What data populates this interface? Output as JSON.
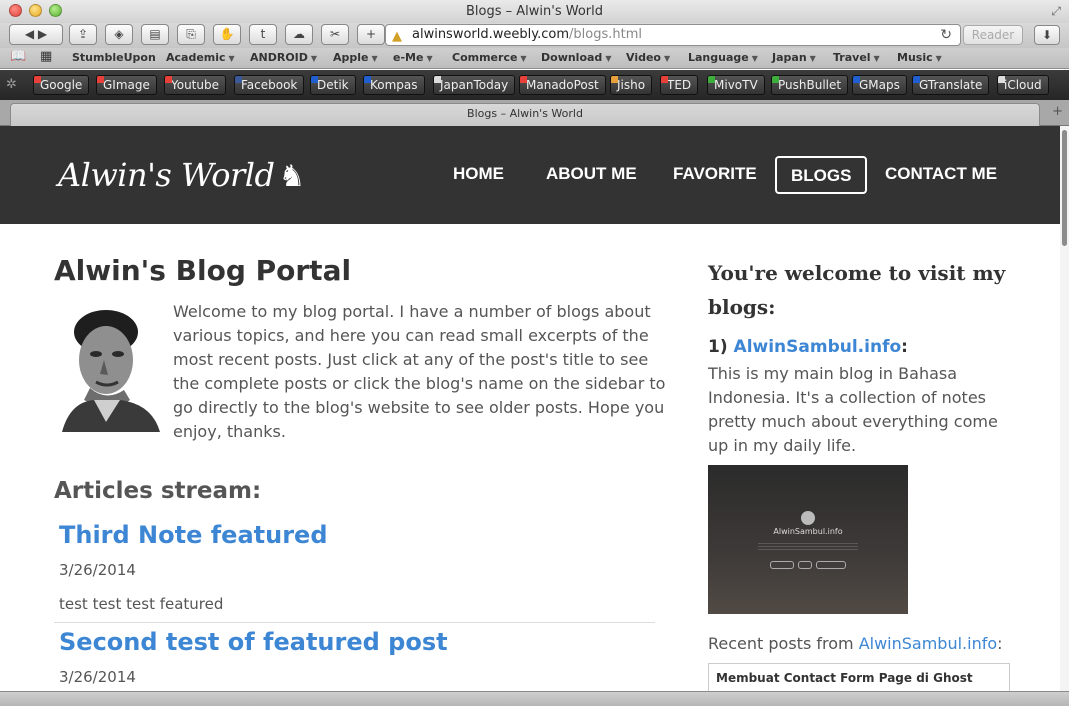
{
  "window": {
    "title": "Blogs – Alwin's World"
  },
  "toolbar": {
    "url_host": "alwinsworld.weebly.com",
    "url_path": "/blogs.html",
    "reader_label": "Reader"
  },
  "bookmarks": [
    {
      "label": "StumbleUpon",
      "menu": false
    },
    {
      "label": "Academic",
      "menu": true
    },
    {
      "label": "ANDROID",
      "menu": true
    },
    {
      "label": "Apple",
      "menu": true
    },
    {
      "label": "e-Me",
      "menu": true
    },
    {
      "label": "Commerce",
      "menu": true
    },
    {
      "label": "Download",
      "menu": true
    },
    {
      "label": "Video",
      "menu": true
    },
    {
      "label": "Language",
      "menu": true
    },
    {
      "label": "Japan",
      "menu": true
    },
    {
      "label": "Travel",
      "menu": true
    },
    {
      "label": "Music",
      "menu": true
    }
  ],
  "extensions": [
    {
      "label": "Google",
      "color": "#e8413a"
    },
    {
      "label": "GImage",
      "color": "#e8413a"
    },
    {
      "label": "Youtube",
      "color": "#e8413a"
    },
    {
      "label": "Facebook",
      "color": "#3b5998"
    },
    {
      "label": "Detik",
      "color": "#1f5fd0"
    },
    {
      "label": "Kompas",
      "color": "#1f5fd0"
    },
    {
      "label": "JapanToday",
      "color": "#dddddd"
    },
    {
      "label": "ManadoPost",
      "color": "#e8413a"
    },
    {
      "label": "Jisho",
      "color": "#e8a13a"
    },
    {
      "label": "TED",
      "color": "#e8413a"
    },
    {
      "label": "MivoTV",
      "color": "#3cae3c"
    },
    {
      "label": "PushBullet",
      "color": "#3cae3c"
    },
    {
      "label": "GMaps",
      "color": "#1f5fd0"
    },
    {
      "label": "GTranslate",
      "color": "#1f5fd0"
    },
    {
      "label": "iCloud",
      "color": "#dddddd"
    }
  ],
  "tab": {
    "title": "Blogs – Alwin's World"
  },
  "site": {
    "logo": "Alwin's World",
    "nav": [
      "HOME",
      "ABOUT ME",
      "FAVORITE",
      "BLOGS",
      "CONTACT ME"
    ],
    "active_nav": "BLOGS"
  },
  "main": {
    "heading": "Alwin's Blog Portal",
    "intro": "Welcome to my blog portal. I have a number of blogs about various topics, and here you can read small excerpts of the most recent posts.  Just click at any of the post's title to see the complete posts or click the blog's name on the sidebar to go directly to the blog's website to see older posts. Hope you enjoy, thanks.",
    "stream_heading": "Articles stream:",
    "posts": [
      {
        "title": "Third Note featured",
        "date": "3/26/2014",
        "excerpt": "test test test featured"
      },
      {
        "title": "Second test of featured post",
        "date": "3/26/2014",
        "excerpt": ""
      }
    ]
  },
  "sidebar": {
    "heading": "You're welcome to visit my blogs:",
    "item_number": "1)",
    "blog_name": "AlwinSambul.info",
    "colon": ":",
    "description": "This is my main blog in Bahasa Indonesia. It's a collection of notes pretty much about everything come up in my daily life.",
    "thumb_title": "AlwinSambul.info",
    "recent_prefix": "Recent posts from",
    "recent_blog": "AlwinSambul.info",
    "recent_suffix": ":",
    "recent_first": "Membuat Contact Form Page di Ghost"
  }
}
